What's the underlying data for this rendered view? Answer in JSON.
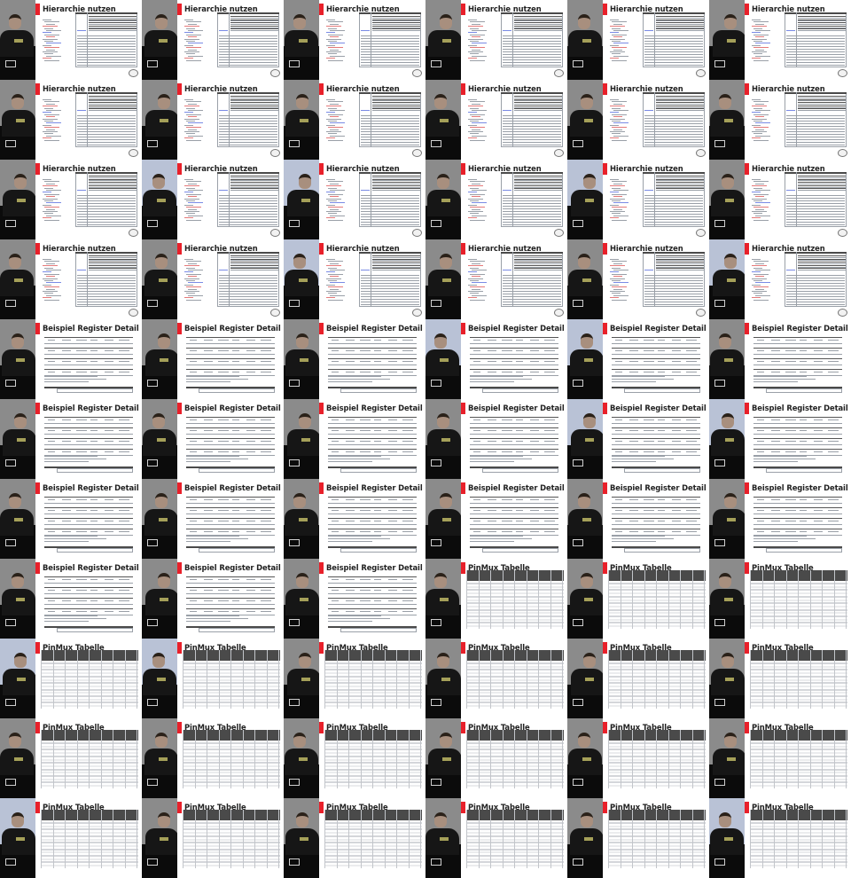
{
  "layout": {
    "columns": 6,
    "rows": 11
  },
  "titles": {
    "hierarchie": "Hierarchie nutzen",
    "register": "Beispiel Register Detail",
    "pinmux": "PinMux Tabelle"
  },
  "frames": [
    "hierarchie",
    "hierarchie",
    "hierarchie",
    "hierarchie",
    "hierarchie",
    "hierarchie",
    "hierarchie",
    "hierarchie",
    "hierarchie",
    "hierarchie",
    "hierarchie",
    "hierarchie",
    "hierarchie",
    "hierarchie",
    "hierarchie",
    "hierarchie",
    "hierarchie",
    "hierarchie",
    "hierarchie",
    "hierarchie",
    "hierarchie",
    "hierarchie",
    "hierarchie",
    "hierarchie",
    "register",
    "register",
    "register",
    "register",
    "register",
    "register",
    "register",
    "register",
    "register",
    "register",
    "register",
    "register",
    "register",
    "register",
    "register",
    "register",
    "register",
    "register",
    "register",
    "register",
    "register",
    "pinmux",
    "pinmux",
    "pinmux",
    "pinmux",
    "pinmux",
    "pinmux",
    "pinmux",
    "pinmux",
    "pinmux",
    "pinmux",
    "pinmux",
    "pinmux",
    "pinmux",
    "pinmux",
    "pinmux",
    "pinmux",
    "pinmux",
    "pinmux",
    "pinmux",
    "pinmux",
    "pinmux"
  ],
  "colors": {
    "accent": "#e8202a",
    "camera_bg": "#0b0b0b"
  }
}
